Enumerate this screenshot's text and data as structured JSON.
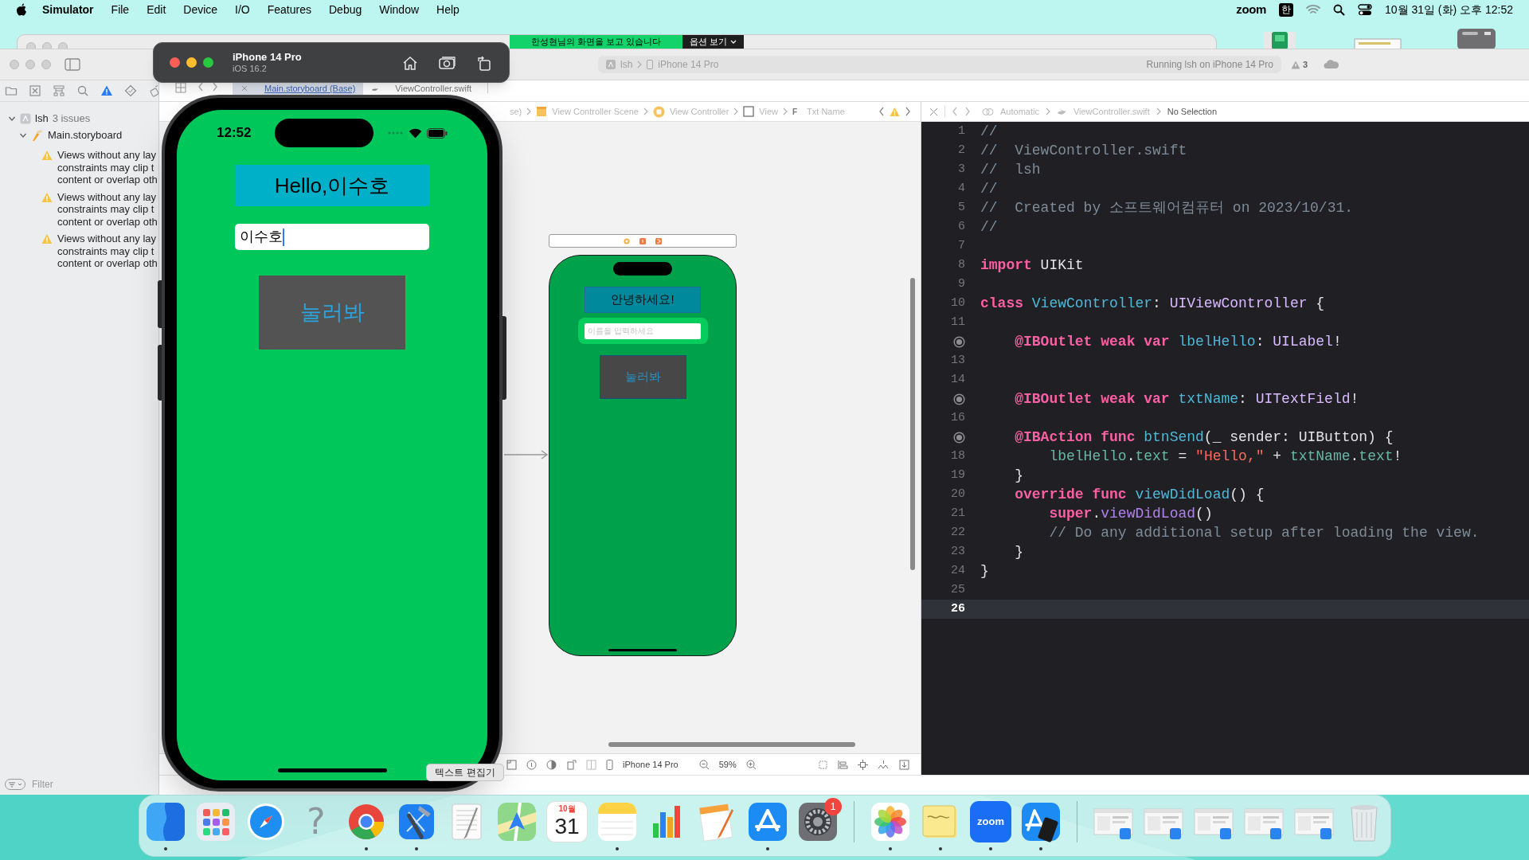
{
  "menu_bar": {
    "app": "Simulator",
    "items": [
      "File",
      "Edit",
      "Device",
      "I/O",
      "Features",
      "Debug",
      "Window",
      "Help"
    ],
    "zoom": "zoom",
    "input_source": "한",
    "clock": "10월 31일 (화) 오후 12:52"
  },
  "screen_share_banner": {
    "message": "한성현님의 화면을 보고 있습니다",
    "options": "옵션 보기"
  },
  "xcode": {
    "toolbar": {
      "scheme": "lsh",
      "destination": "iPhone 14 Pro",
      "status": "Running lsh on iPhone 14 Pro",
      "warnings": "3"
    },
    "navigator": {
      "tabs": [
        {
          "kind": "files",
          "selected": false
        },
        {
          "kind": "source",
          "selected": false
        },
        {
          "kind": "symbols",
          "selected": false
        },
        {
          "kind": "find",
          "selected": false
        },
        {
          "kind": "issues",
          "selected": true
        },
        {
          "kind": "tests",
          "selected": false
        },
        {
          "kind": "debug",
          "selected": false
        }
      ],
      "project": "lsh",
      "issue_count": "3 issues",
      "expanded": true,
      "file": {
        "name": "Main.storyboard",
        "expanded": true
      },
      "issues": [
        {
          "lines": [
            "Views without any lay",
            "constraints may clip t",
            "content or overlap oth"
          ]
        },
        {
          "lines": [
            "Views without any lay",
            "constraints may clip t",
            "content or overlap oth"
          ]
        },
        {
          "lines": [
            "Views without any lay",
            "constraints may clip t",
            "content or overlap oth"
          ]
        }
      ],
      "filter_placeholder": "Filter"
    },
    "tabs": [
      {
        "label": "Main.storyboard (Base)",
        "selected": true
      },
      {
        "label": "ViewController.swift",
        "selected": false
      }
    ],
    "storyboard": {
      "jump_bar": [
        {
          "kind": "text",
          "label": "se)"
        },
        {
          "kind": "scene",
          "label": "View Controller Scene"
        },
        {
          "kind": "controller",
          "label": "View Controller"
        },
        {
          "kind": "view",
          "label": "View"
        },
        {
          "kind": "field",
          "badge": "F",
          "label": "Txt Name"
        }
      ],
      "scene": {
        "label": "안녕하세요!",
        "field": {
          "placeholder": "이름을 입력하세요",
          "selected": true
        },
        "button": "눌러봐"
      },
      "bottom_bar": {
        "device": "iPhone 14 Pro",
        "zoom": "59%"
      }
    },
    "code_editor": {
      "jump_bar": [
        "Automatic",
        "ViewController.swift",
        "No Selection"
      ],
      "lines": [
        {
          "kind": "number",
          "number": "1",
          "current": false,
          "tokens": [
            {
              "kind": "comment",
              "text": "//"
            }
          ]
        },
        {
          "kind": "number",
          "number": "2",
          "current": false,
          "tokens": [
            {
              "kind": "comment",
              "text": "//  ViewController.swift"
            }
          ]
        },
        {
          "kind": "number",
          "number": "3",
          "current": false,
          "tokens": [
            {
              "kind": "comment",
              "text": "//  lsh"
            }
          ]
        },
        {
          "kind": "number",
          "number": "4",
          "current": false,
          "tokens": [
            {
              "kind": "comment",
              "text": "//"
            }
          ]
        },
        {
          "kind": "number",
          "number": "5",
          "current": false,
          "tokens": [
            {
              "kind": "comment",
              "text": "//  Created by 소프트웨어컴퓨터 on 2023/10/31."
            }
          ]
        },
        {
          "kind": "number",
          "number": "6",
          "current": false,
          "tokens": [
            {
              "kind": "comment",
              "text": "//"
            }
          ]
        },
        {
          "kind": "number",
          "number": "7",
          "current": false
        },
        {
          "kind": "number",
          "number": "8",
          "current": false,
          "tokens": [
            {
              "kind": "keyword",
              "text": "import"
            },
            {
              "kind": "plain",
              "text": " UIKit"
            }
          ]
        },
        {
          "kind": "number",
          "number": "9",
          "current": false
        },
        {
          "kind": "number",
          "number": "10",
          "current": false,
          "tokens": [
            {
              "kind": "keyword",
              "text": "class"
            },
            {
              "kind": "decl",
              "text": " ViewController"
            },
            {
              "kind": "plain",
              "text": ": "
            },
            {
              "kind": "type",
              "text": "UIViewController"
            },
            {
              "kind": "plain",
              "text": " {"
            }
          ]
        },
        {
          "kind": "number",
          "number": "11",
          "current": false
        },
        {
          "kind": "outlet",
          "current": false,
          "tokens": [
            {
              "kind": "keyword",
              "text": "    @IBOutlet weak var"
            },
            {
              "kind": "decl",
              "text": " lbelHello"
            },
            {
              "kind": "plain",
              "text": ": "
            },
            {
              "kind": "type",
              "text": "UILabel"
            },
            {
              "kind": "plain",
              "text": "!"
            }
          ]
        },
        {
          "kind": "number",
          "number": "13",
          "current": false
        },
        {
          "kind": "number",
          "number": "14",
          "current": false
        },
        {
          "kind": "outlet",
          "current": false,
          "tokens": [
            {
              "kind": "keyword",
              "text": "    @IBOutlet weak var"
            },
            {
              "kind": "decl",
              "text": " txtName"
            },
            {
              "kind": "plain",
              "text": ": "
            },
            {
              "kind": "type",
              "text": "UITextField"
            },
            {
              "kind": "plain",
              "text": "!"
            }
          ]
        },
        {
          "kind": "number",
          "number": "16",
          "current": false
        },
        {
          "kind": "outlet",
          "current": false,
          "tokens": [
            {
              "kind": "keyword",
              "text": "    @IBAction func"
            },
            {
              "kind": "decl",
              "text": " btnSend"
            },
            {
              "kind": "plain",
              "text": "(_ sender: UIButton) {"
            }
          ]
        },
        {
          "kind": "number",
          "number": "18",
          "current": false,
          "tokens": [
            {
              "kind": "member",
              "text": "        lbelHello"
            },
            {
              "kind": "plain",
              "text": "."
            },
            {
              "kind": "member",
              "text": "text"
            },
            {
              "kind": "plain",
              "text": " = "
            },
            {
              "kind": "string",
              "text": "\"Hello,\""
            },
            {
              "kind": "plain",
              "text": " + "
            },
            {
              "kind": "member",
              "text": "txtName"
            },
            {
              "kind": "plain",
              "text": "."
            },
            {
              "kind": "member",
              "text": "text"
            },
            {
              "kind": "plain",
              "text": "!"
            }
          ]
        },
        {
          "kind": "number",
          "number": "19",
          "current": false,
          "tokens": [
            {
              "kind": "plain",
              "text": "    }"
            }
          ]
        },
        {
          "kind": "number",
          "number": "20",
          "current": false,
          "tokens": [
            {
              "kind": "keyword",
              "text": "    override func"
            },
            {
              "kind": "decl",
              "text": " viewDidLoad"
            },
            {
              "kind": "plain",
              "text": "() {"
            }
          ]
        },
        {
          "kind": "number",
          "number": "21",
          "current": false,
          "tokens": [
            {
              "kind": "keyword",
              "text": "        super"
            },
            {
              "kind": "plain",
              "text": "."
            },
            {
              "kind": "method",
              "text": "viewDidLoad"
            },
            {
              "kind": "plain",
              "text": "()"
            }
          ]
        },
        {
          "kind": "number",
          "number": "22",
          "current": false,
          "tokens": [
            {
              "kind": "comment",
              "text": "        // Do any additional setup after loading the view."
            }
          ]
        },
        {
          "kind": "number",
          "number": "23",
          "current": false,
          "tokens": [
            {
              "kind": "plain",
              "text": "    }"
            }
          ]
        },
        {
          "kind": "number",
          "number": "24",
          "current": false,
          "tokens": [
            {
              "kind": "plain",
              "text": "}"
            }
          ]
        },
        {
          "kind": "number",
          "number": "25",
          "current": false
        },
        {
          "kind": "number",
          "number": "26",
          "current": true
        }
      ]
    }
  },
  "simulator": {
    "device": "iPhone 14 Pro",
    "os": "iOS 16.2",
    "screen": {
      "time": "12:52",
      "label": "Hello,이수호",
      "field_value": "이수호",
      "button": "눌러봐"
    }
  },
  "tooltip": "텍스트 편집기",
  "dock": {
    "apps": [
      {
        "kind": "finder",
        "running": true
      },
      {
        "kind": "launchpad",
        "running": false
      },
      {
        "kind": "safari",
        "running": false
      },
      {
        "kind": "help",
        "glyph": "?",
        "running": false
      },
      {
        "kind": "chrome",
        "running": true
      },
      {
        "kind": "xcode",
        "running": true
      },
      {
        "kind": "textedit",
        "running": false
      },
      {
        "kind": "maps",
        "running": false
      },
      {
        "kind": "calendar",
        "month": "10월",
        "day": "31",
        "running": false
      },
      {
        "kind": "notes",
        "running": true
      },
      {
        "kind": "numbers",
        "running": false
      },
      {
        "kind": "pages",
        "running": false
      },
      {
        "kind": "appstore",
        "running": true
      },
      {
        "kind": "settings",
        "badge": "1",
        "running": false
      }
    ],
    "recent": [
      {
        "kind": "photos",
        "running": true
      },
      {
        "kind": "stickies",
        "running": true
      },
      {
        "kind": "zoom",
        "label": "zoom",
        "running": true
      },
      {
        "kind": "simulator",
        "running": true
      }
    ],
    "windows": [
      {
        "kind": "window"
      },
      {
        "kind": "window"
      },
      {
        "kind": "window"
      },
      {
        "kind": "window"
      },
      {
        "kind": "window"
      },
      {
        "kind": "trash"
      }
    ]
  }
}
